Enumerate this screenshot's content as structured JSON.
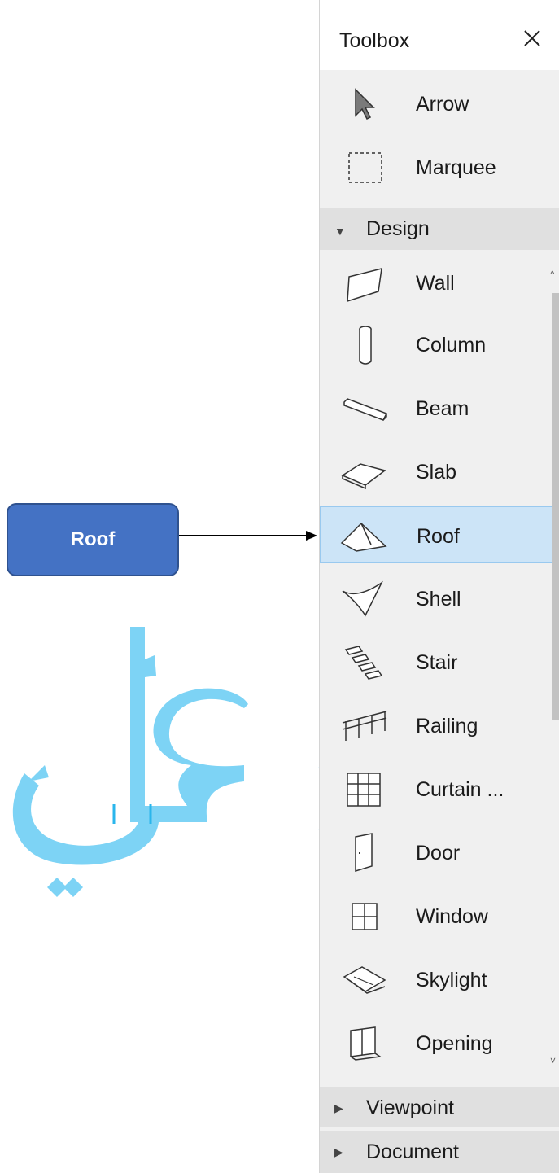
{
  "panel": {
    "title": "Toolbox",
    "close_icon": "close-icon",
    "top_tools": [
      {
        "label": "Arrow",
        "icon": "arrow-cursor-icon"
      },
      {
        "label": "Marquee",
        "icon": "marquee-icon"
      }
    ],
    "sections": {
      "design": {
        "label": "Design",
        "expanded": true
      },
      "viewpoint": {
        "label": "Viewpoint",
        "expanded": false
      },
      "document": {
        "label": "Document",
        "expanded": false
      }
    },
    "design_tools": [
      {
        "label": "Wall",
        "icon": "wall-icon"
      },
      {
        "label": "Column",
        "icon": "column-icon"
      },
      {
        "label": "Beam",
        "icon": "beam-icon"
      },
      {
        "label": "Slab",
        "icon": "slab-icon"
      },
      {
        "label": "Roof",
        "icon": "roof-icon",
        "selected": true
      },
      {
        "label": "Shell",
        "icon": "shell-icon"
      },
      {
        "label": "Stair",
        "icon": "stair-icon"
      },
      {
        "label": "Railing",
        "icon": "railing-icon"
      },
      {
        "label": "Curtain ...",
        "icon": "curtain-wall-icon"
      },
      {
        "label": "Door",
        "icon": "door-icon"
      },
      {
        "label": "Window",
        "icon": "window-icon"
      },
      {
        "label": "Skylight",
        "icon": "skylight-icon"
      },
      {
        "label": "Opening",
        "icon": "opening-icon"
      }
    ]
  },
  "callout": {
    "label": "Roof",
    "color": "#4472c4"
  },
  "watermark": {
    "text": "علي",
    "color": "#7dd3f5"
  },
  "colors": {
    "selected_bg": "#cce4f7",
    "panel_bg": "#f0f0f0",
    "section_bg": "#e0e0e0"
  }
}
